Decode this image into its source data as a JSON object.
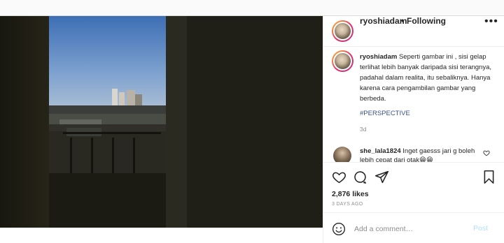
{
  "post": {
    "author": "ryoshiadam",
    "separator": "•",
    "follow_status": "Following",
    "more_icon": "more-icon"
  },
  "caption": {
    "username": "ryoshiadam",
    "text": "Seperti gambar ini , sisi gelap terlihat lebih banyak daripada sisi terangnya, padahal dalam realita, itu sebaliknya. Hanya karena cara pengambilan gambar yang berbeda.",
    "hashtag": "#PERSPECTIVE",
    "time": "3d"
  },
  "comments": [
    {
      "username": "she_lala1824",
      "text": "Inget gaesss jari g boleh lebih cepat dari otak😁😁"
    }
  ],
  "actions": {
    "like_icon": "heart-icon",
    "comment_icon": "comment-icon",
    "share_icon": "share-icon",
    "save_icon": "bookmark-icon"
  },
  "likes": "2,876 likes",
  "date": "3 DAYS AGO",
  "add_comment": {
    "placeholder": "Add a comment…",
    "post_label": "Post",
    "emoji_icon": "emoji-icon"
  },
  "colors": {
    "link": "#385185",
    "muted": "#8e8e8e",
    "post_disabled": "#b2dffc",
    "border": "#efefef"
  }
}
